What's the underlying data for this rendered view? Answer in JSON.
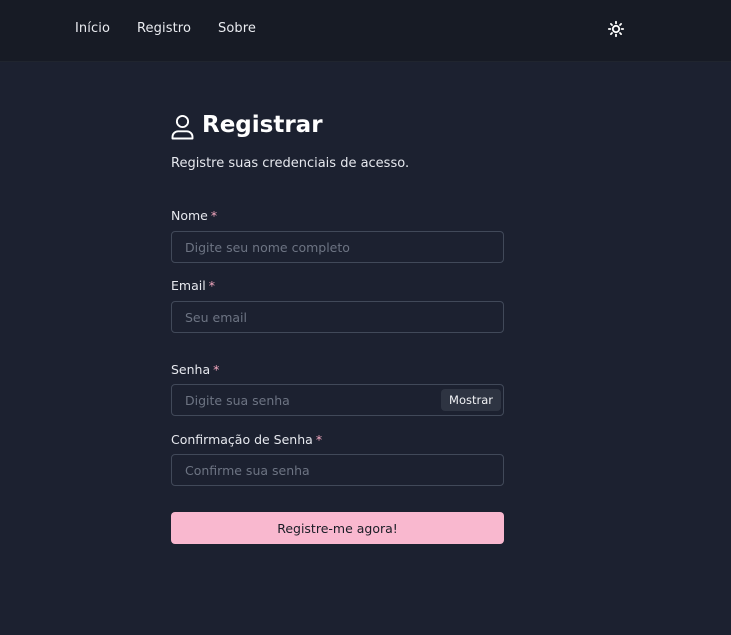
{
  "nav": {
    "items": [
      {
        "label": "Início"
      },
      {
        "label": "Registro"
      },
      {
        "label": "Sobre"
      }
    ],
    "theme_icon": "sun-icon"
  },
  "page": {
    "title": "Registrar",
    "title_icon": "user-icon",
    "subtitle": "Registre suas credenciais de acesso."
  },
  "form": {
    "required_marker": "*",
    "fields": {
      "name": {
        "label": "Nome",
        "placeholder": "Digite seu nome completo",
        "value": ""
      },
      "email": {
        "label": "Email",
        "placeholder": "Seu email",
        "value": ""
      },
      "password": {
        "label": "Senha",
        "placeholder": "Digite sua senha",
        "value": "",
        "toggle_label": "Mostrar"
      },
      "password_confirm": {
        "label": "Confirmação de Senha",
        "placeholder": "Confirme sua senha",
        "value": ""
      }
    },
    "submit_label": "Registre-me agora!"
  },
  "colors": {
    "background": "#1c2130",
    "navbar": "#171b25",
    "accent": "#f9b8cf",
    "required": "#f4a9c0"
  }
}
